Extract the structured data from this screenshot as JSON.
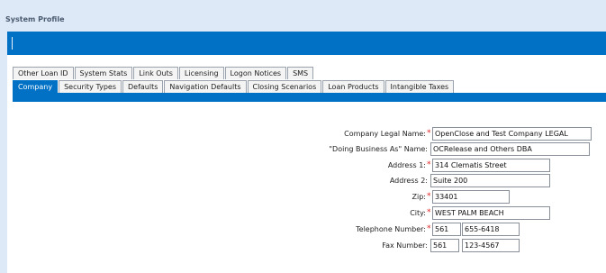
{
  "page": {
    "title": "System Profile"
  },
  "tabs_row1": [
    {
      "label": "Other Loan ID"
    },
    {
      "label": "System Stats"
    },
    {
      "label": "Link Outs"
    },
    {
      "label": "Licensing"
    },
    {
      "label": "Logon Notices"
    },
    {
      "label": "SMS"
    }
  ],
  "tabs_row2": [
    {
      "label": "Company",
      "active": true
    },
    {
      "label": "Security Types"
    },
    {
      "label": "Defaults"
    },
    {
      "label": "Navigation Defaults"
    },
    {
      "label": "Closing Scenarios"
    },
    {
      "label": "Loan Products"
    },
    {
      "label": "Intangible Taxes"
    }
  ],
  "form": {
    "legal_name": {
      "label": "Company Legal Name:",
      "value": "OpenClose and Test Company LEGAL"
    },
    "dba": {
      "label": "\"Doing Business As\" Name:",
      "value": "OCRelease and Others DBA"
    },
    "address1": {
      "label": "Address 1:",
      "value": "314 Clematis Street"
    },
    "address2": {
      "label": "Address 2:",
      "value": "Suite 200"
    },
    "zip": {
      "label": "Zip:",
      "value": "33401"
    },
    "city": {
      "label": "City:",
      "value": "WEST PALM BEACH"
    },
    "telephone": {
      "label": "Telephone Number:",
      "area": "561",
      "number": "655-6418"
    },
    "fax": {
      "label": "Fax Number:",
      "area": "561",
      "number": "123-4567"
    }
  },
  "colors": {
    "accent": "#0071c5",
    "required": "#e02020",
    "background": "#dde9f6"
  }
}
